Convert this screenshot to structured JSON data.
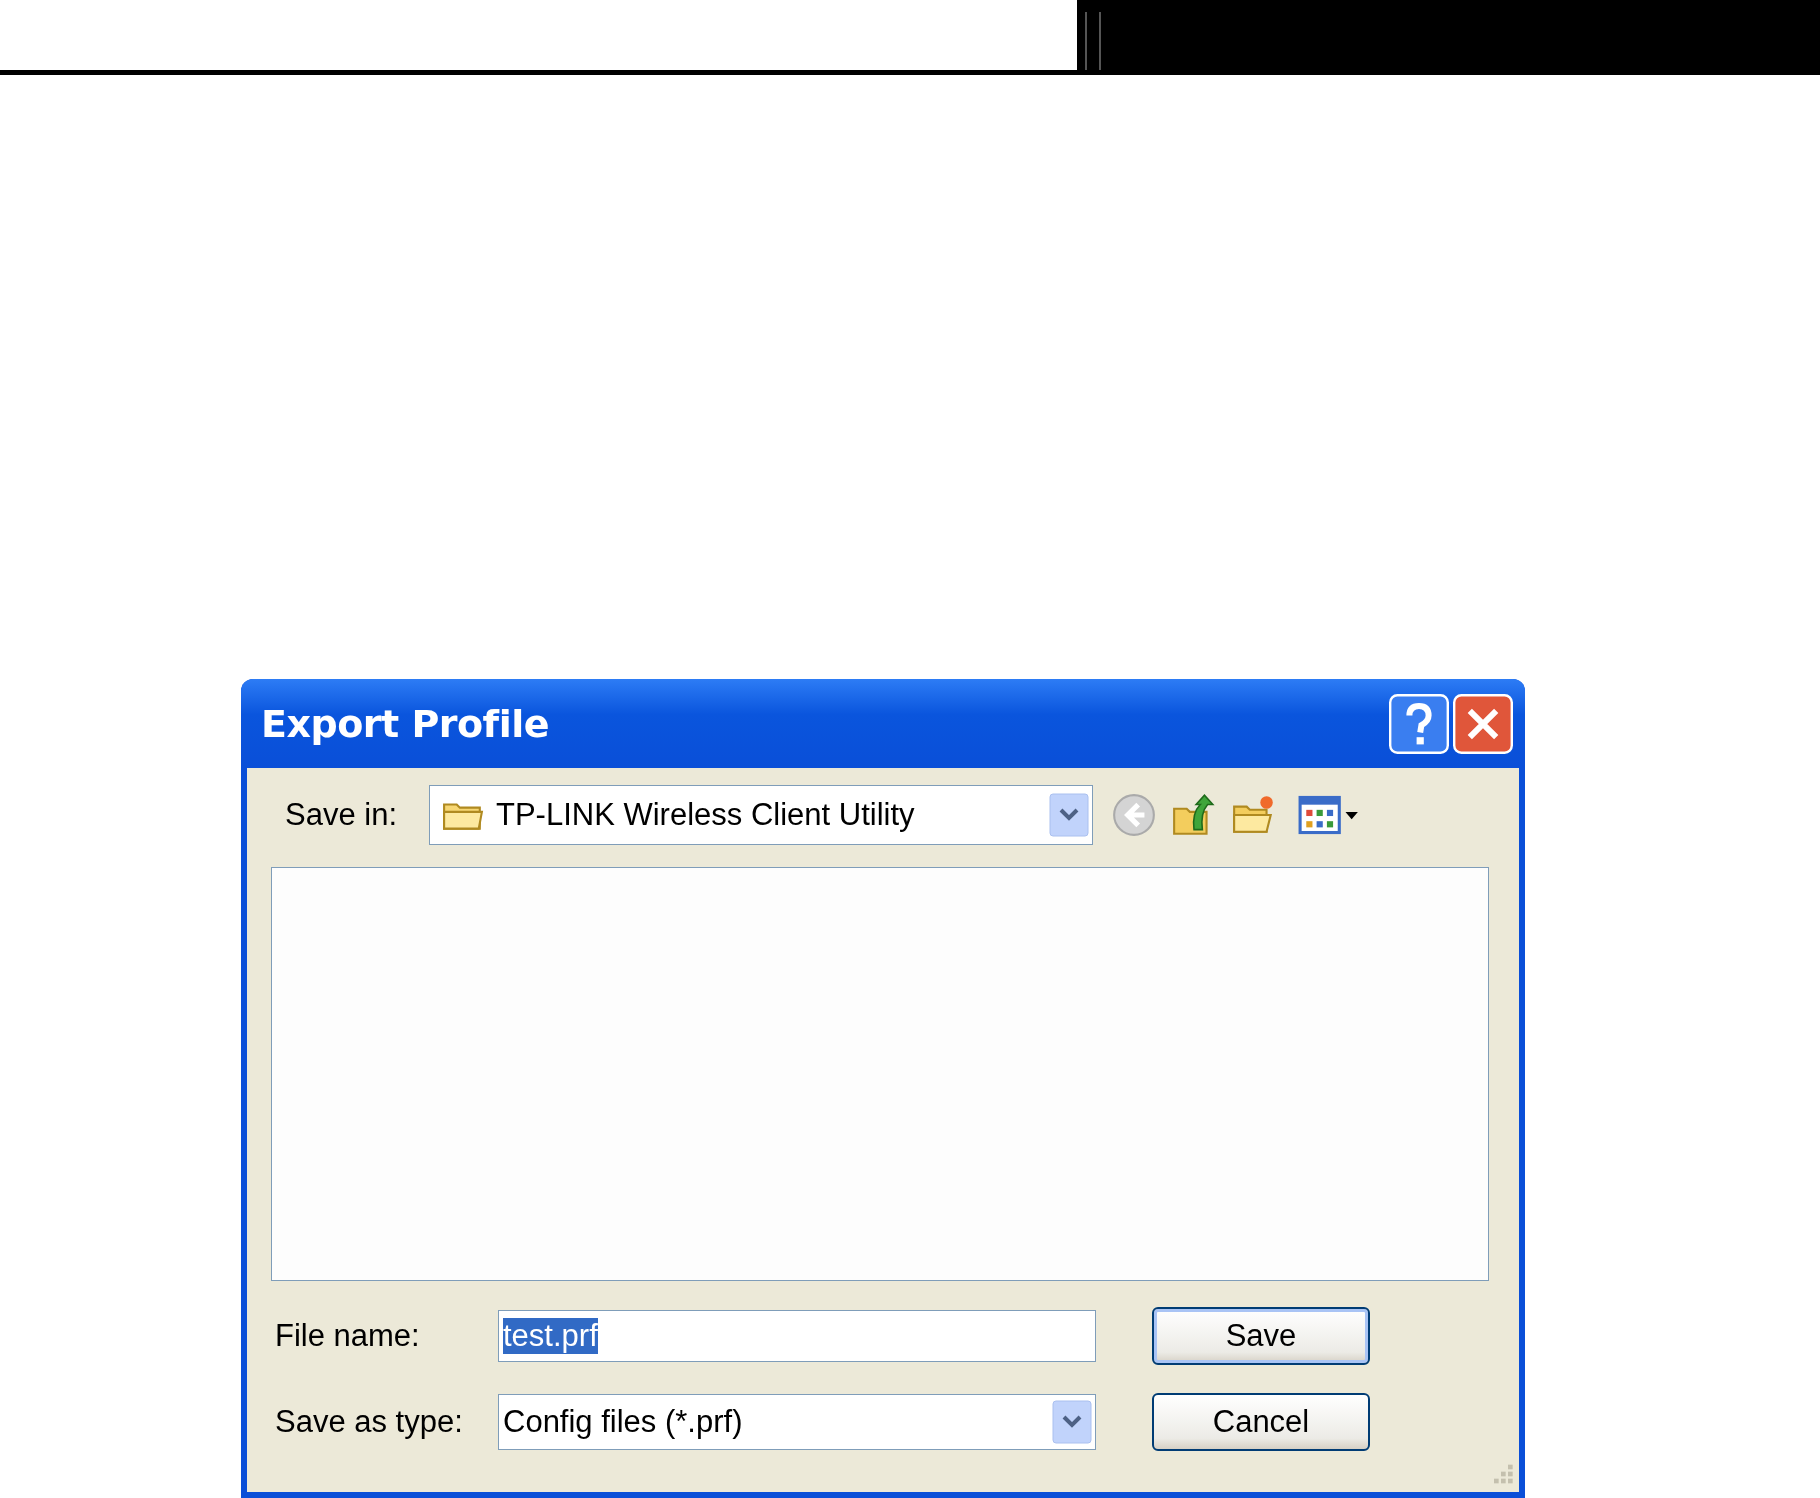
{
  "dialog": {
    "title": "Export Profile",
    "save_in": {
      "label": "Save in:",
      "value": "TP-LINK Wireless Client Utility"
    },
    "file_name": {
      "label": "File name:",
      "value": "test.prf",
      "selected": true
    },
    "save_as_type": {
      "label": "Save as type:",
      "value": "Config files (*.prf)"
    },
    "buttons": [
      {
        "label": "Save",
        "default": true
      },
      {
        "label": "Cancel",
        "default": false
      }
    ]
  }
}
